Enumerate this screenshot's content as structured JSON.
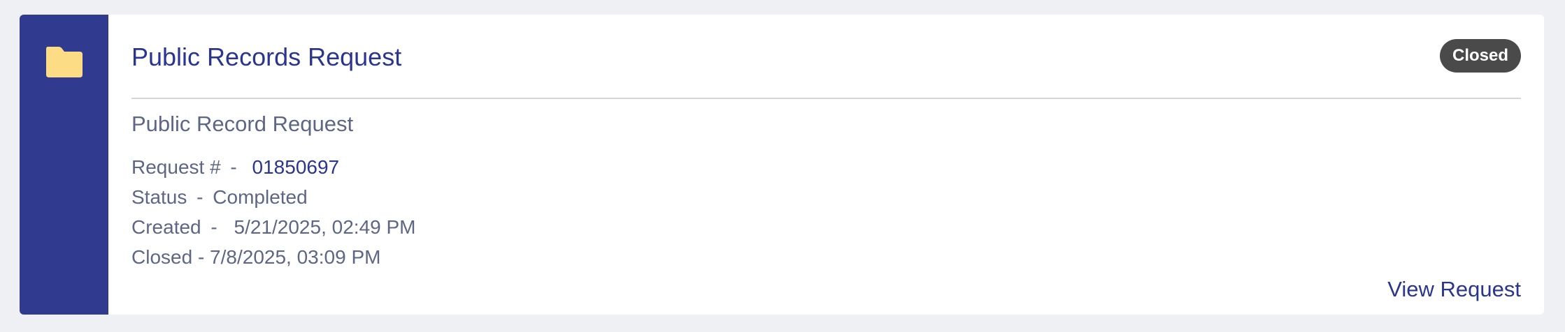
{
  "card": {
    "title": "Public Records Request",
    "status_badge": "Closed",
    "icon": "folder-icon",
    "subtitle": "Public Record Request",
    "request_label": "Request #",
    "request_sep": "-",
    "request_number": "01850697",
    "status_label": "Status",
    "status_sep": "-",
    "status_value": "Completed",
    "created_label": "Created",
    "created_sep": "-",
    "created_value": "5/21/2025, 02:49 PM",
    "closed_text": "Closed - 7/8/2025, 03:09 PM",
    "view_link": "View Request"
  },
  "colors": {
    "accent": "#303a8e",
    "link": "#2a3590",
    "muted_text": "#5d6784",
    "badge_bg": "#4a4a4a",
    "folder": "#fcdc84",
    "page_bg": "#eff0f3"
  }
}
